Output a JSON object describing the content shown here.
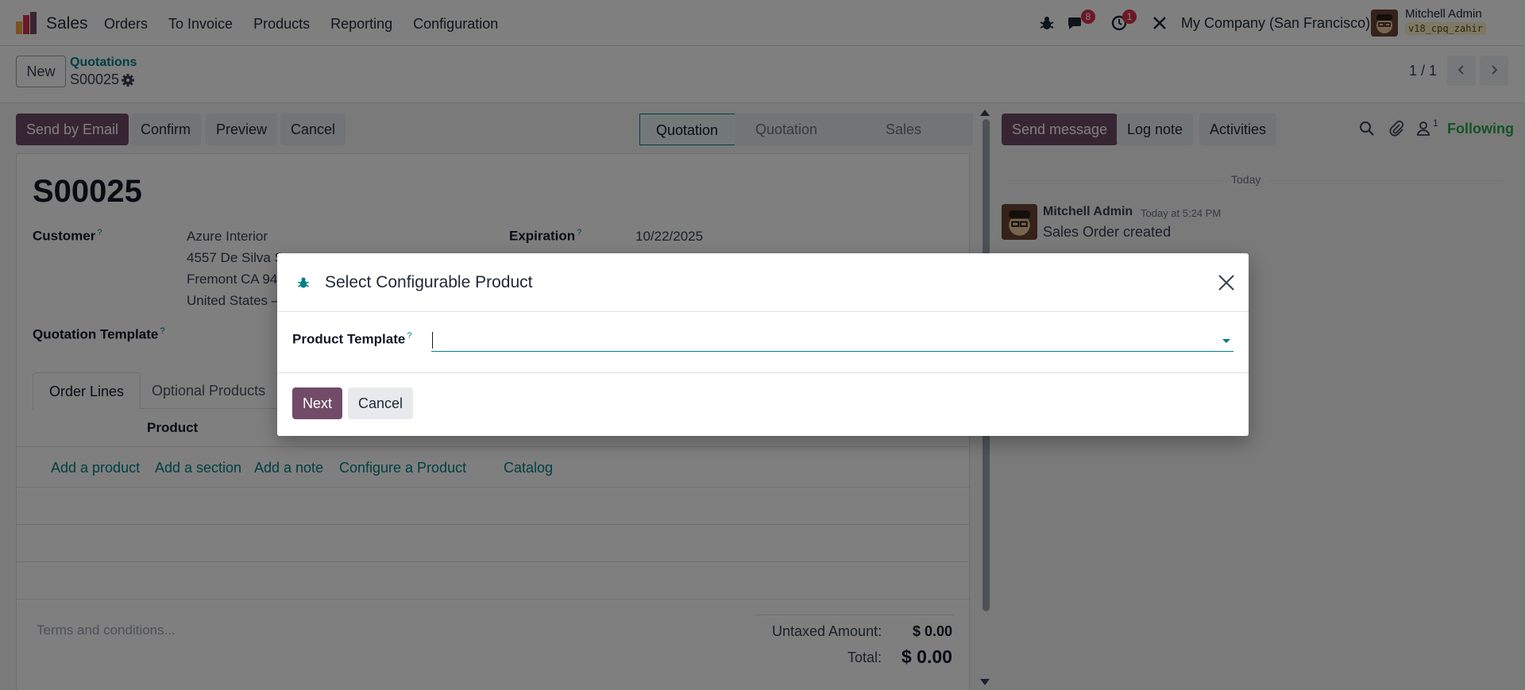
{
  "navbar": {
    "app_name": "Sales",
    "menu": [
      "Orders",
      "To Invoice",
      "Products",
      "Reporting",
      "Configuration"
    ],
    "messages_count": "8",
    "activities_count": "1",
    "company": "My Company (San Francisco)",
    "user_name": "Mitchell Admin",
    "db_name": "v18_cpq_zahir"
  },
  "control_panel": {
    "new_label": "New",
    "breadcrumb_parent": "Quotations",
    "breadcrumb_current": "S00025",
    "pager": "1 / 1"
  },
  "actions": {
    "send_email": "Send by Email",
    "confirm": "Confirm",
    "preview": "Preview",
    "cancel": "Cancel"
  },
  "status_steps": [
    "Quotation",
    "Quotation Sent",
    "Sales Order"
  ],
  "form": {
    "title": "S00025",
    "customer_label": "Customer",
    "customer_lines": [
      "Azure Interior",
      "4557 De Silva S",
      "Fremont CA 94",
      "United States –"
    ],
    "expiration_label": "Expiration",
    "expiration_value": "10/22/2025",
    "template_label": "Quotation Template",
    "help_mark": "?",
    "tabs": [
      "Order Lines",
      "Optional Products"
    ],
    "product_col": "Product",
    "links": [
      "Add a product",
      "Add a section",
      "Add a note",
      "Configure a Product",
      "Catalog"
    ],
    "terms_placeholder": "Terms and conditions...",
    "untaxed_label": "Untaxed Amount:",
    "untaxed_value": "$ 0.00",
    "total_label": "Total:",
    "total_value": "$ 0.00"
  },
  "chatter": {
    "send_message": "Send message",
    "log_note": "Log note",
    "activities": "Activities",
    "followers_count": "1",
    "following": "Following",
    "today": "Today",
    "author": "Mitchell Admin",
    "time": "Today at 5:24 PM",
    "body": "Sales Order created"
  },
  "modal": {
    "title": "Select Configurable Product",
    "field_label": "Product Template",
    "help_mark": "?",
    "field_value": "",
    "next": "Next",
    "cancel": "Cancel"
  },
  "colors": {
    "primary": "#714b67",
    "accent": "#017e84",
    "badge": "#d9314c",
    "following": "#28a745"
  }
}
